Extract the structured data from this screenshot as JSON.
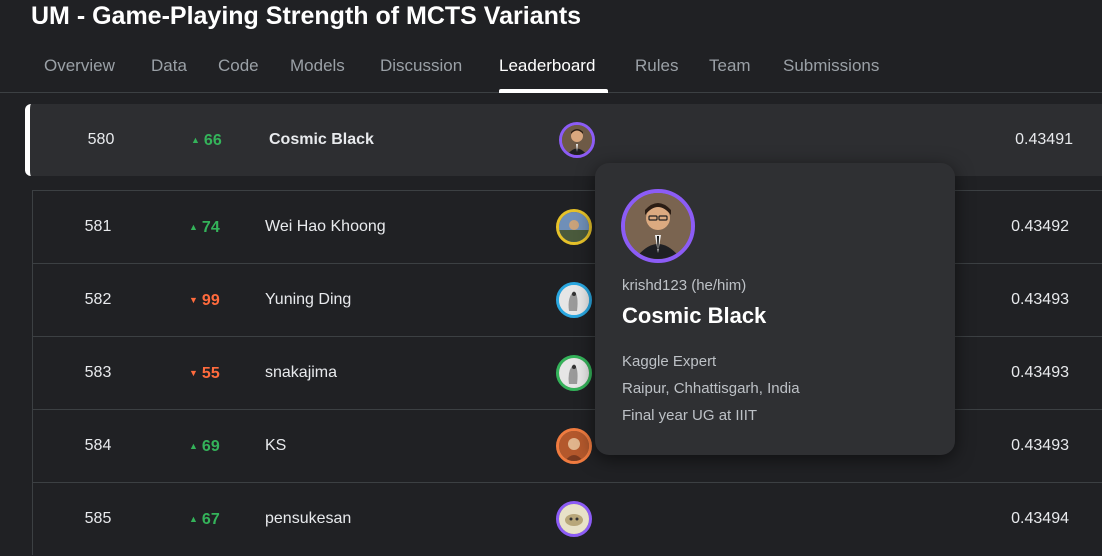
{
  "competition": {
    "title": "UM - Game-Playing Strength of MCTS Variants"
  },
  "tabs": [
    {
      "label": "Overview"
    },
    {
      "label": "Data"
    },
    {
      "label": "Code"
    },
    {
      "label": "Models"
    },
    {
      "label": "Discussion"
    },
    {
      "label": "Leaderboard",
      "active": true
    },
    {
      "label": "Rules"
    },
    {
      "label": "Team"
    },
    {
      "label": "Submissions"
    }
  ],
  "leaderboard": {
    "rows": [
      {
        "rank": "580",
        "delta": "66",
        "direction": "up",
        "team": "Cosmic Black",
        "score": "0.43491",
        "avatar_ring": "#8c5cf6",
        "highlight": true
      },
      {
        "rank": "581",
        "delta": "74",
        "direction": "up",
        "team": "Wei Hao Khoong",
        "score": "0.43492",
        "avatar_ring": "#e6c229"
      },
      {
        "rank": "582",
        "delta": "99",
        "direction": "down",
        "team": "Yuning Ding",
        "score": "0.43493",
        "avatar_ring": "#2aa7e0"
      },
      {
        "rank": "583",
        "delta": "55",
        "direction": "down",
        "team": "snakajima",
        "score": "0.43493",
        "avatar_ring": "#34b35a"
      },
      {
        "rank": "584",
        "delta": "69",
        "direction": "up",
        "team": "KS",
        "score": "0.43493",
        "avatar_ring": "#f07b3f"
      },
      {
        "rank": "585",
        "delta": "67",
        "direction": "up",
        "team": "pensukesan",
        "score": "0.43494",
        "avatar_ring": "#8c5cf6"
      }
    ]
  },
  "tooltip": {
    "username": "krishd123 (he/him)",
    "display_name": "Cosmic Black",
    "tier": "Kaggle Expert",
    "location": "Raipur, Chhattisgarh, India",
    "bio": "Final year UG at IIIT"
  },
  "colors": {
    "background": "#202124",
    "up": "#34b35a",
    "down": "#ff6b3d",
    "expert_ring": "#8c5cf6"
  }
}
